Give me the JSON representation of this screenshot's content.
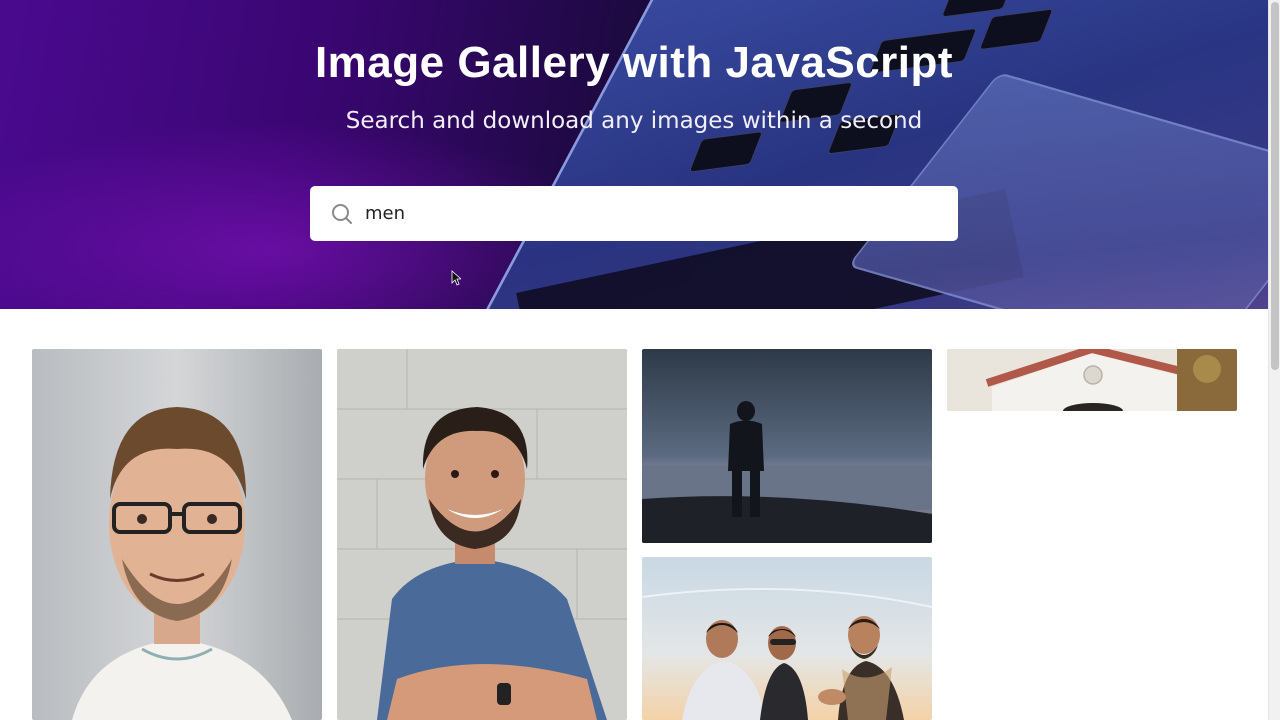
{
  "hero": {
    "title": "Image Gallery with JavaScript",
    "subtitle": "Search and download any images within a second"
  },
  "search": {
    "value": "men",
    "icon": "search-icon"
  },
  "gallery": {
    "images": [
      {
        "description": "portrait-man-glasses"
      },
      {
        "description": "man-blue-tshirt-arms-crossed"
      },
      {
        "description": "man-silhouette-lake"
      },
      {
        "description": "white-house-roof"
      },
      {
        "description": "men-talking-sunset"
      }
    ]
  },
  "colors": {
    "hero_purple": "#4a0a8f",
    "hero_blue": "#2b3580",
    "search_bg": "#ffffff"
  }
}
